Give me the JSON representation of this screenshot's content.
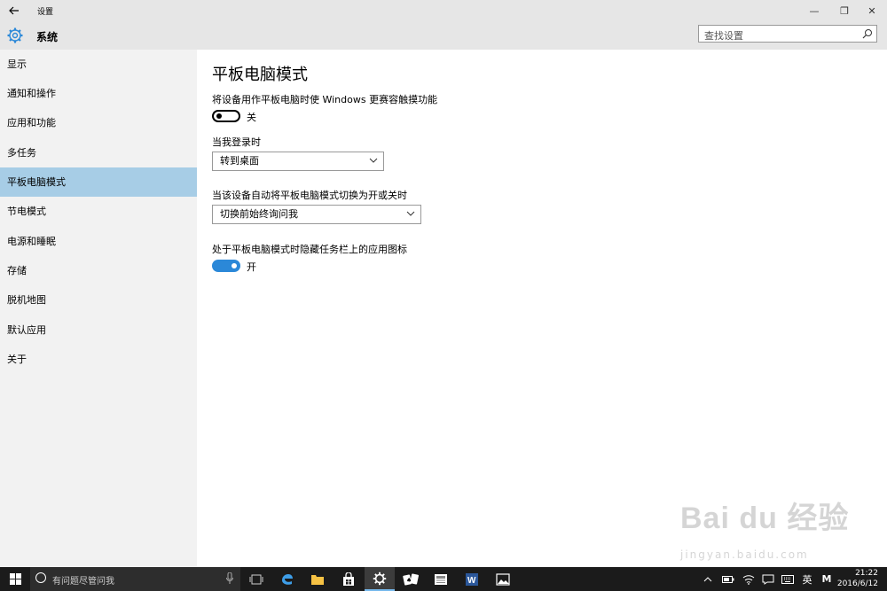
{
  "window": {
    "title": "设置",
    "minimize_glyph": "—",
    "restore_glyph": "❐",
    "close_glyph": "✕"
  },
  "header": {
    "title": "系统",
    "search_placeholder": "查找设置"
  },
  "sidebar": {
    "items": [
      {
        "label": "显示"
      },
      {
        "label": "通知和操作"
      },
      {
        "label": "应用和功能"
      },
      {
        "label": "多任务"
      },
      {
        "label": "平板电脑模式",
        "selected": true
      },
      {
        "label": "节电模式"
      },
      {
        "label": "电源和睡眠"
      },
      {
        "label": "存储"
      },
      {
        "label": "脱机地图"
      },
      {
        "label": "默认应用"
      },
      {
        "label": "关于"
      }
    ]
  },
  "main": {
    "title": "平板电脑模式",
    "touch_setting": {
      "label": "将设备用作平板电脑时使 Windows 更赛容触摸功能",
      "state": "关",
      "on": false
    },
    "signin": {
      "label": "当我登录时",
      "value": "转到桌面"
    },
    "autoswitch": {
      "label": "当该设备自动将平板电脑模式切换为开或关时",
      "value": "切换前始终询问我"
    },
    "hide_icons": {
      "label": "处于平板电脑模式时隐藏任务栏上的应用图标",
      "state": "开",
      "on": true
    }
  },
  "taskbar": {
    "search_text": "有问题尽管问我",
    "apps": [
      "task-view-icon",
      "edge-icon",
      "file-explorer-icon",
      "store-icon",
      "settings-icon",
      "solitaire-icon",
      "news-icon",
      "word-icon",
      "photos-icon"
    ],
    "tray": {
      "ime_label": "英",
      "ime_mode": "M"
    },
    "time": "21:22",
    "date": "2016/6/12"
  },
  "watermark": {
    "main": "Bai du 经验",
    "sub": "jingyan.baidu.com"
  },
  "colors": {
    "accent": "#2b88d8",
    "selected_nav": "#a7cde6",
    "chrome": "#e6e6e6",
    "sidebar": "#f2f2f2",
    "taskbar": "#1b1b1b"
  }
}
